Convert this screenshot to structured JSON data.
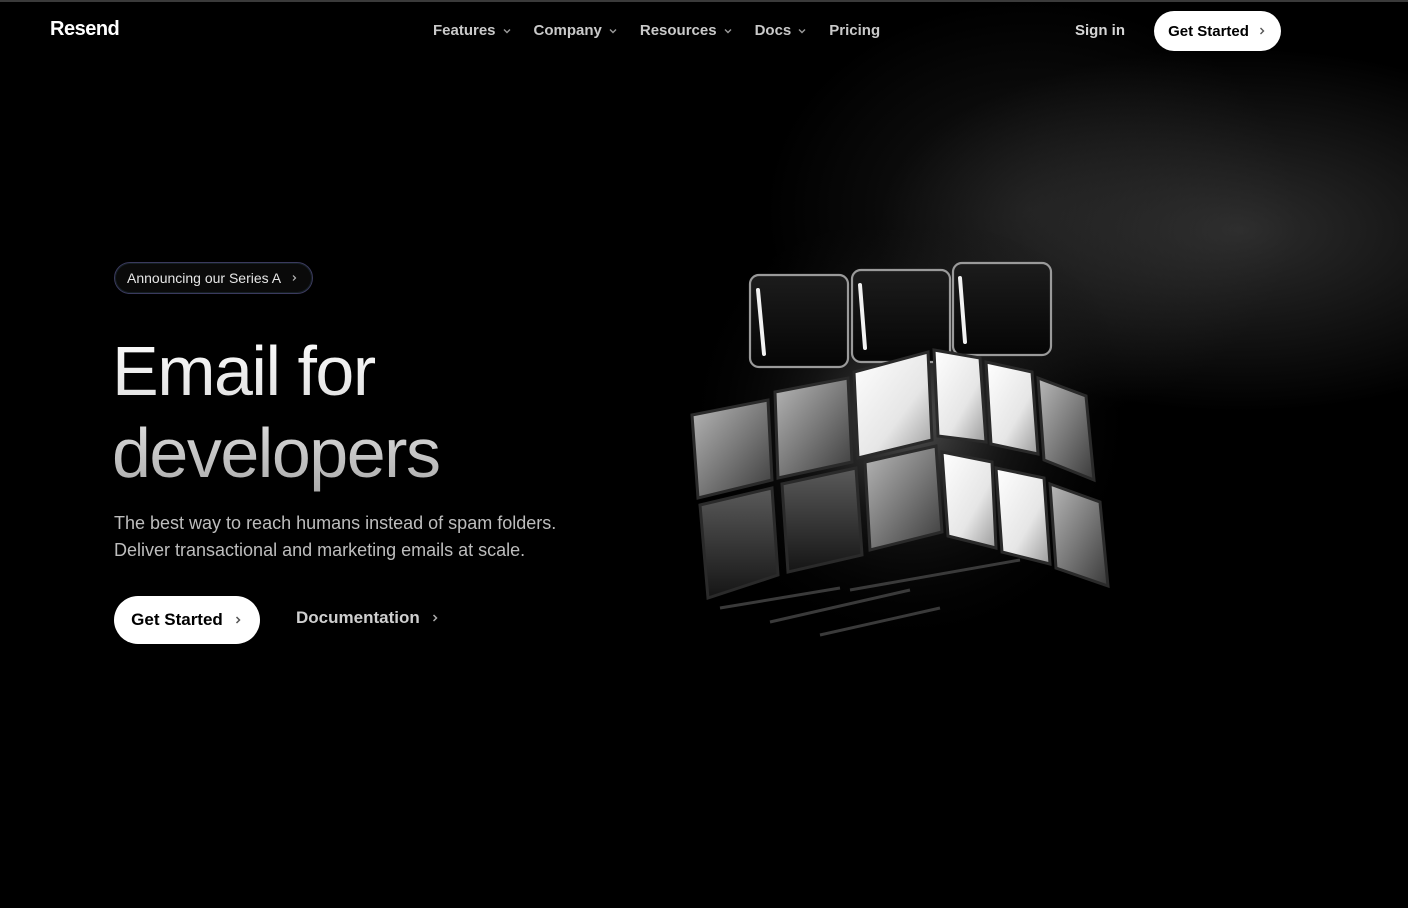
{
  "brand": {
    "logo_text": "Resend"
  },
  "nav": {
    "items": [
      {
        "label": "Features",
        "has_dropdown": true
      },
      {
        "label": "Company",
        "has_dropdown": true
      },
      {
        "label": "Resources",
        "has_dropdown": true
      },
      {
        "label": "Docs",
        "has_dropdown": true
      },
      {
        "label": "Pricing",
        "has_dropdown": false
      }
    ],
    "sign_in": "Sign in",
    "cta": "Get Started"
  },
  "hero": {
    "announcement": "Announcing our Series A",
    "headline_line1": "Email for",
    "headline_line2": "developers",
    "subtext_line1": "The best way to reach humans instead of spam folders.",
    "subtext_line2": "Deliver transactional and marketing emails at scale.",
    "primary_cta": "Get Started",
    "secondary_cta": "Documentation"
  },
  "colors": {
    "background": "#000000",
    "button_bg": "#ffffff",
    "button_text": "#000000",
    "announce_border": "#3b3a5e"
  },
  "icons": {
    "nav_dropdown": "chevron-down-icon",
    "cta_arrow": "chevron-right-icon",
    "hero_graphic": "rubiks-cube-graphic"
  }
}
